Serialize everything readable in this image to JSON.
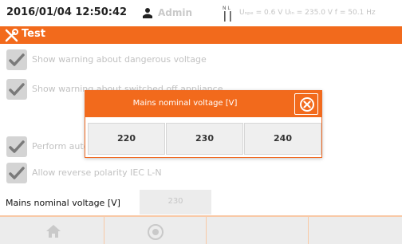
{
  "status_bar": {
    "datetime": "2016/01/04 12:50:42",
    "user": "Admin",
    "nl_label": "N L",
    "measurements": "Uₙₚₑ = 0.6 V Uₗₙ = 235.0 V f = 50.1 Hz"
  },
  "title_bar": {
    "title": "Test",
    "icon": "tools-icon"
  },
  "settings": {
    "items": [
      {
        "label": "Show warning about dangerous voltage",
        "checked": true
      },
      {
        "label": "Show warning about switched off appliance",
        "checked": true
      },
      {
        "label": "Perform automatic retest",
        "checked": true
      },
      {
        "label": "Allow reverse polarity IEC L-N",
        "checked": true
      }
    ],
    "mains_voltage": {
      "label": "Mains nominal voltage [V]",
      "value": "230"
    }
  },
  "popup": {
    "title": "Mains nominal voltage [V]",
    "options": [
      "220",
      "230",
      "240"
    ]
  },
  "bottom_bar": {
    "buttons": [
      "home-icon",
      "ok-icon"
    ]
  },
  "colors": {
    "accent": "#f26a1c",
    "disabled_text": "#c2c2c2",
    "checkbox_bg": "#d4d4d4"
  }
}
